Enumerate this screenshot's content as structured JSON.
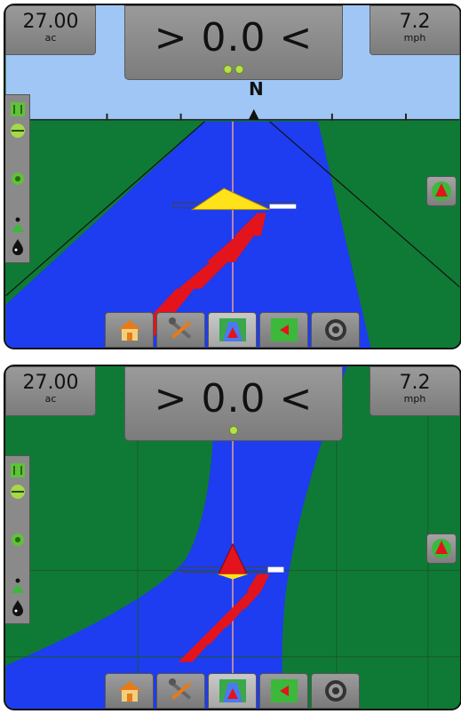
{
  "screens": [
    {
      "id": "vehicle-view",
      "area": {
        "value": "27.00",
        "unit": "ac"
      },
      "cross_track": "> 0.0 <",
      "speed": {
        "value": "7.2",
        "unit": "mph"
      },
      "compass": "N",
      "led_count": 2
    },
    {
      "id": "overhead-view",
      "area": {
        "value": "27.00",
        "unit": "ac"
      },
      "cross_track": "> 0.0 <",
      "speed": {
        "value": "7.2",
        "unit": "mph"
      },
      "led_count": 1
    }
  ],
  "sidebar_icons": [
    "boom-width-icon",
    "bar-icon",
    "tractor-icon",
    "guidance-icon",
    "drop-icon"
  ],
  "nav_buttons": [
    {
      "icon": "home-icon",
      "label": "Home"
    },
    {
      "icon": "tools-icon",
      "label": "Tools"
    },
    {
      "icon": "guidance-view-icon",
      "label": "Guidance"
    },
    {
      "icon": "map-icon",
      "label": "Map"
    },
    {
      "icon": "gauge-icon",
      "label": "Gauge"
    }
  ],
  "colors": {
    "field": "#0f7a35",
    "sky": "#9fc6f5",
    "swath": "#1e3cf0",
    "applied": "#e3141b",
    "panel": "#8b8b8b"
  }
}
